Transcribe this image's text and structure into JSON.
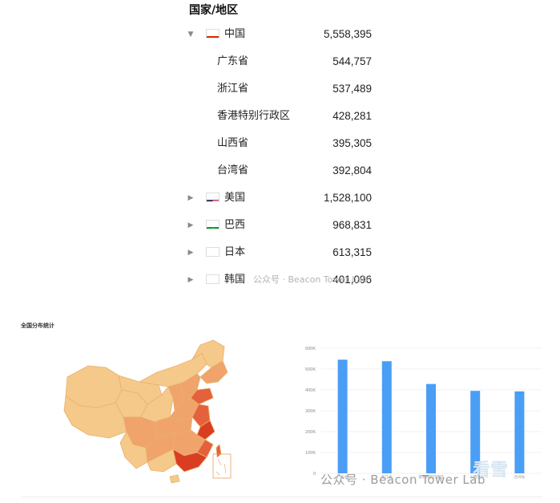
{
  "tree": {
    "header": "国家/地区",
    "rows": [
      {
        "name": "中国",
        "value": "5,558,395",
        "level": 0,
        "expanded": true,
        "flag": "china-flag"
      },
      {
        "name": "广东省",
        "value": "544,757",
        "level": 1
      },
      {
        "name": "浙江省",
        "value": "537,489",
        "level": 1
      },
      {
        "name": "香港特别行政区",
        "value": "428,281",
        "level": 1
      },
      {
        "name": "山西省",
        "value": "395,305",
        "level": 1
      },
      {
        "name": "台湾省",
        "value": "392,804",
        "level": 1
      },
      {
        "name": "美国",
        "value": "1,528,100",
        "level": 0,
        "expanded": false,
        "flag": "usa-flag"
      },
      {
        "name": "巴西",
        "value": "968,831",
        "level": 0,
        "expanded": false,
        "flag": "brazil-flag"
      },
      {
        "name": "日本",
        "value": "613,315",
        "level": 0,
        "expanded": false,
        "flag": "japan-flag"
      },
      {
        "name": "韩国",
        "value": "401,096",
        "level": 0,
        "expanded": false,
        "flag": "korea-flag"
      }
    ]
  },
  "watermark_top": "公众号 · Beacon Tower Lab",
  "map": {
    "title": "全国分布统计",
    "colors": {
      "low": "#f5c98a",
      "mid": "#f0a46c",
      "high": "#e4613c",
      "top": "#d93e22"
    }
  },
  "chart_data": {
    "type": "bar",
    "categories": [
      "广东省",
      "浙江省",
      "香港特别行政区",
      "山西省",
      "台湾省"
    ],
    "values": [
      544757,
      537489,
      428281,
      395305,
      392804
    ],
    "ylim": [
      0,
      600000
    ],
    "yticks": [
      "0",
      "100K",
      "200K",
      "300K",
      "400K",
      "500K",
      "600K"
    ],
    "grid": true,
    "bar_color": "#4a9ef5"
  },
  "watermark_bottom": "公众号 · Beacon Tower Lab",
  "watermark_logo": "看雪"
}
